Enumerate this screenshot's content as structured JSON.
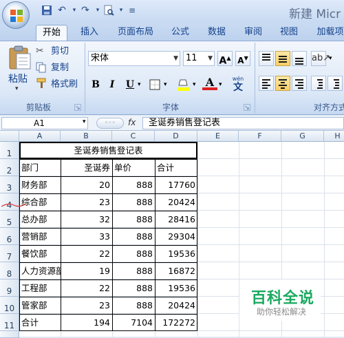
{
  "app": {
    "title": "新建 Micr"
  },
  "tabs": [
    "开始",
    "插入",
    "页面布局",
    "公式",
    "数据",
    "审阅",
    "视图",
    "加载项"
  ],
  "clipboard": {
    "paste": "粘贴",
    "cut": "剪切",
    "copy": "复制",
    "format_painter": "格式刷",
    "group": "剪贴板"
  },
  "font": {
    "name": "宋体",
    "size": "11",
    "group": "字体",
    "bold": "B",
    "italic": "I",
    "underline": "U",
    "wen": "wén",
    "grow": "A",
    "shrink": "A",
    "color_a": "A"
  },
  "alignment": {
    "group": "对齐方式"
  },
  "formula_bar": {
    "cell_ref": "A1",
    "fx": "fx",
    "value": "圣诞券销售登记表"
  },
  "columns": [
    "A",
    "B",
    "C",
    "D",
    "E",
    "F",
    "G",
    "H"
  ],
  "rows": [
    "1",
    "2",
    "3",
    "4",
    "5",
    "6",
    "7",
    "8",
    "9",
    "10",
    "11"
  ],
  "table": {
    "title": "圣诞券销售登记表",
    "headers": [
      "部门",
      "圣诞券",
      "单价",
      "合计"
    ],
    "data": [
      [
        "财务部",
        "20",
        "888",
        "17760"
      ],
      [
        "综合部",
        "23",
        "888",
        "20424"
      ],
      [
        "总办部",
        "32",
        "888",
        "28416"
      ],
      [
        "营销部",
        "33",
        "888",
        "29304"
      ],
      [
        "餐饮部",
        "22",
        "888",
        "19536"
      ],
      [
        "人力资源部",
        "19",
        "888",
        "16872"
      ],
      [
        "工程部",
        "22",
        "888",
        "19536"
      ],
      [
        "管家部",
        "23",
        "888",
        "20424"
      ],
      [
        "合计",
        "194",
        "7104",
        "172272"
      ]
    ]
  },
  "watermark": {
    "title": "百科全说",
    "subtitle": "助你轻松解决"
  },
  "colors": {
    "ribbon": "#dce8f7",
    "tab_text": "#15428b",
    "watermark": "#1aa95f"
  }
}
